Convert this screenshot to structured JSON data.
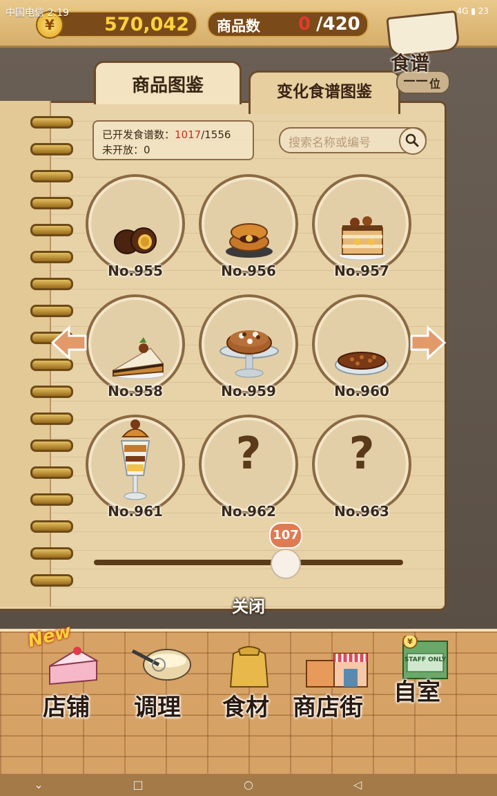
{
  "status_bar": {
    "carrier_time": "中国电信 2:19",
    "right": "4G ▮ 23"
  },
  "header": {
    "coins": "570,042",
    "coin_symbol": "¥",
    "products_label": "商品数",
    "products_current": "0",
    "products_max": "/420",
    "recipe_label": "食谱",
    "rank_value": "——",
    "rank_unit": "位"
  },
  "tabs": [
    {
      "label": "商品图鉴",
      "active": true
    },
    {
      "label": "变化食谱图鉴",
      "active": false
    }
  ],
  "counter": {
    "developed_label": "已开发食谱数：",
    "developed_value": "1017",
    "developed_total": "/1556",
    "undeveloped_label": "未开放：",
    "undeveloped_value": "0"
  },
  "search": {
    "placeholder": "搜索名称或编号"
  },
  "items": [
    {
      "number": "No.955",
      "food": "chestnut-bun",
      "unknown": false
    },
    {
      "number": "No.956",
      "food": "chestnut-dorayaki",
      "unknown": false
    },
    {
      "number": "No.957",
      "food": "chestnut-layer-cake",
      "unknown": false
    },
    {
      "number": "No.958",
      "food": "chestnut-tart-slice",
      "unknown": false
    },
    {
      "number": "No.959",
      "food": "chestnut-cake-on-stand",
      "unknown": false
    },
    {
      "number": "No.960",
      "food": "chestnut-pie",
      "unknown": false
    },
    {
      "number": "No.961",
      "food": "chestnut-parfait",
      "unknown": false
    },
    {
      "number": "No.962",
      "food": "unknown",
      "unknown": true,
      "mark": "?"
    },
    {
      "number": "No.963",
      "food": "unknown",
      "unknown": true,
      "mark": "?"
    }
  ],
  "slider": {
    "page": "107"
  },
  "close_label": "关闭",
  "bottom_nav": {
    "new_badge": "New",
    "items": [
      {
        "label": "店铺",
        "icon": "cake-icon"
      },
      {
        "label": "调理",
        "icon": "mixing-bowl-icon"
      },
      {
        "label": "食材",
        "icon": "flour-sack-icon"
      },
      {
        "label": "商店街",
        "icon": "shop-street-icon"
      },
      {
        "label": "自室",
        "icon": "staff-only-door-icon",
        "sign_text": "STAFF ONLY"
      }
    ]
  },
  "system_nav": {
    "back": "◁",
    "home": "○",
    "recent": "□",
    "down": "⌄"
  }
}
